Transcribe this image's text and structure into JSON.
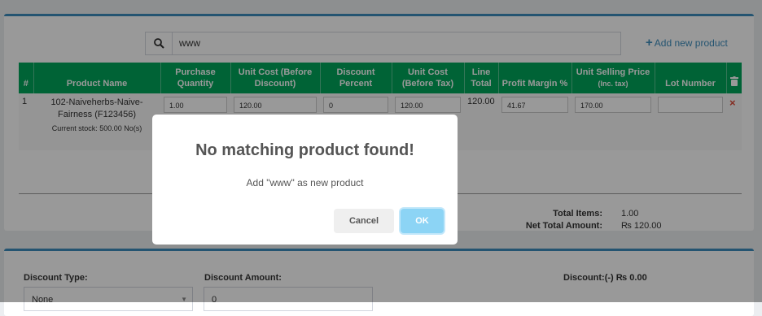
{
  "search": {
    "value": "www"
  },
  "add_new_product": {
    "label": "Add new product"
  },
  "table": {
    "headers": {
      "index": "#",
      "product_name": "Product Name",
      "purchase_quantity": "Purchase Quantity",
      "unit_cost_before_discount": "Unit Cost (Before Discount)",
      "discount_percent": "Discount Percent",
      "unit_cost_before_tax": "Unit Cost (Before Tax)",
      "line_total": "Line Total",
      "profit_margin": "Profit Margin %",
      "unit_selling_price": "Unit Selling Price",
      "unit_selling_price_sub": "(Inc. tax)",
      "lot_number": "Lot Number"
    },
    "rows": [
      {
        "index": "1",
        "product_name": "102-Naiveherbs-Naive-Fairness (F123456)",
        "stock": "Current stock: 500.00 No(s)",
        "purchase_quantity": "1.00",
        "unit_cost_before_discount": "120.00",
        "discount_percent": "0",
        "unit_cost_before_tax": "120.00",
        "line_total": "120.00",
        "profit_margin": "41.67",
        "unit_selling_price": "170.00",
        "lot_number": "",
        "remove": "×"
      }
    ]
  },
  "totals": {
    "items_label": "Total Items:",
    "items_value": "1.00",
    "net_label": "Net Total Amount:",
    "net_value": "₨ 120.00"
  },
  "discount": {
    "type_label": "Discount Type:",
    "type_value": "None",
    "amount_label": "Discount Amount:",
    "amount_value": "0",
    "summary": "Discount:(-) ₨ 0.00"
  },
  "modal": {
    "title": "No matching product found!",
    "text": "Add \"www\" as new product",
    "cancel": "Cancel",
    "ok": "OK"
  },
  "colors": {
    "header_green": "#00a65a",
    "accent_blue": "#3c8dbc",
    "ok_button": "#8cd4f5",
    "remove_red": "#dd4b39"
  },
  "icons": [
    "search-icon",
    "plus-icon",
    "trash-icon",
    "remove-icon",
    "caret-down-icon"
  ]
}
